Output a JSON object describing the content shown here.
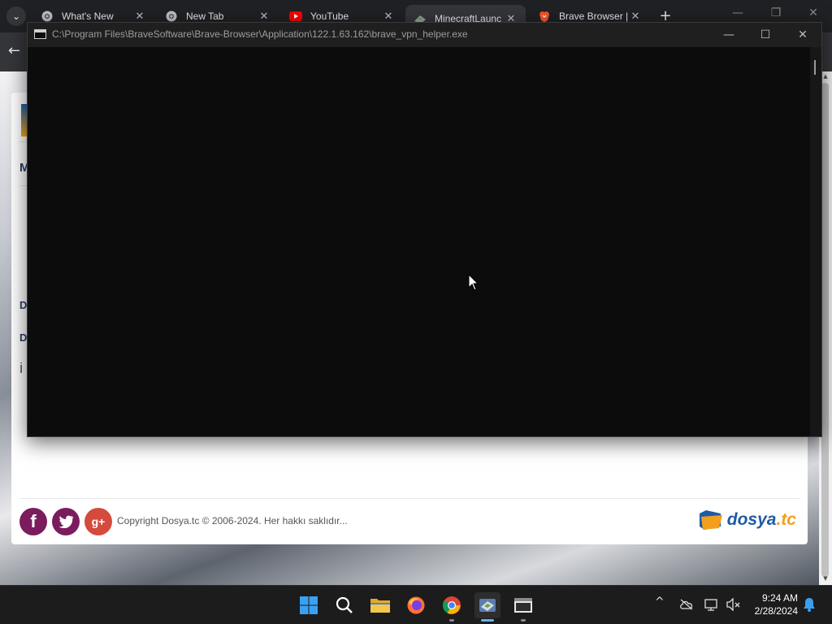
{
  "browser": {
    "tabs": [
      {
        "label": "What's New",
        "favicon": "chrome-icon"
      },
      {
        "label": "New Tab",
        "favicon": "chrome-icon"
      },
      {
        "label": "YouTube",
        "favicon": "youtube-icon"
      },
      {
        "label": "MinecraftLaunc",
        "favicon": "minecraft-launcher-icon",
        "active": true
      },
      {
        "label": "Brave Browser |",
        "favicon": "brave-icon"
      }
    ],
    "new_tab_label": "+",
    "close_glyph": "✕",
    "tab_search_glyph": "⌄",
    "back_glyph": "←",
    "window_controls": {
      "minimize": "—",
      "maximize": "❐",
      "close": "✕"
    }
  },
  "page": {
    "card_letters": [
      "M",
      "D",
      "D",
      "İ"
    ],
    "footer": {
      "social": {
        "facebook": "f",
        "twitter": "t",
        "googleplus": "g+"
      },
      "copyright": "Copyright Dosya.tc © 2006-2024. Her hakkı saklıdır...",
      "brand": {
        "name": "dosya",
        "tld": ".tc"
      }
    }
  },
  "console": {
    "title": "C:\\Program Files\\BraveSoftware\\Brave-Browser\\Application\\122.1.63.162\\brave_vpn_helper.exe",
    "controls": {
      "minimize": "—",
      "maximize": "☐",
      "close": "✕"
    }
  },
  "taskbar": {
    "apps": [
      "windows-start-icon",
      "search-icon",
      "file-explorer-icon",
      "firefox-icon",
      "chrome-icon",
      "minecraft-launcher-icon",
      "console-icon"
    ],
    "clock": {
      "time": "9:24 AM",
      "date": "2/28/2024"
    },
    "tray": {
      "chevron": "^"
    }
  },
  "colors": {
    "console_bg": "#0c0c0c",
    "taskbar_bg": "#1c1c1c",
    "brand_blue": "#1f5aa6",
    "brand_orange": "#f29f1c"
  }
}
